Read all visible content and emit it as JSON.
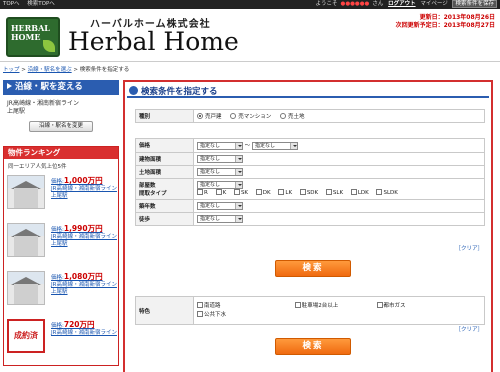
{
  "topbar": {
    "nav": [
      "TOPへ",
      "検索TOPへ"
    ],
    "welcome_prefix": "ようこそ",
    "user_name": "●●●●●●",
    "welcome_suffix": "さん",
    "logout": "ログアウト",
    "mypage": "マイページ",
    "action": "検索条件を保存"
  },
  "header": {
    "logo_text_1": "HERBAL",
    "logo_text_2": "HOME",
    "company_jp": "ハーバルホーム株式会社",
    "company_en": "Herbal Home",
    "updated": "更新日：2013年08月26日",
    "next_update": "次回更新予定日：2013年08月27日"
  },
  "breadcrumb": {
    "home": "トップ",
    "step1": "沿線・駅名を選ぶ",
    "current": "検索条件を指定する",
    "sep": ">"
  },
  "sidebar": {
    "heading": "沿線・駅を変える",
    "line": "JR高崎線・湘南新宿ライン",
    "station": "上尾駅",
    "change_button": "沿線・駅名を変更",
    "ranking_heading": "物件ランキング",
    "ranking_sub": "同一エリア人気上位5件",
    "items": [
      {
        "price_label": "価格:",
        "price": "1,000万円",
        "line": "JR高崎線・湘南新宿ライン",
        "station": "上尾駅",
        "sold": ""
      },
      {
        "price_label": "価格:",
        "price": "1,990万円",
        "line": "JR高崎線・湘南新宿ライン",
        "station": "上尾駅",
        "sold": ""
      },
      {
        "price_label": "価格:",
        "price": "1,080万円",
        "line": "JR高崎線・湘南新宿ライン",
        "station": "上尾駅",
        "sold": ""
      },
      {
        "price_label": "価格:",
        "price": "720万円",
        "line": "JR高崎線・湘南新宿ライン",
        "station": "",
        "sold": "成約済"
      }
    ]
  },
  "main": {
    "title": "検索条件を指定する",
    "type_label": "種別",
    "types": [
      "売戸建",
      "売マンション",
      "売土地"
    ],
    "selected_type": "売戸建",
    "price_label": "価格",
    "price_from": "指定なし",
    "price_sep": "～",
    "price_to": "指定なし",
    "building_area_label": "建物面積",
    "building_area": "指定なし",
    "land_area_label": "土地面積",
    "land_area": "指定なし",
    "rooms_label_1": "部屋数",
    "rooms_label_2": "間取タイプ",
    "rooms": "指定なし",
    "layouts": [
      "R",
      "K",
      "SK",
      "DK",
      "LK",
      "SDK",
      "SLK",
      "LDK",
      "SLDK"
    ],
    "age_label": "築年数",
    "age": "指定なし",
    "walk_label": "徒歩",
    "walk": "指定なし",
    "clear": "［クリア］",
    "search_button": "検索",
    "feature_label": "特色",
    "features": [
      "南道路",
      "駐車場2台以上",
      "都市ガス",
      "公共下水"
    ]
  }
}
